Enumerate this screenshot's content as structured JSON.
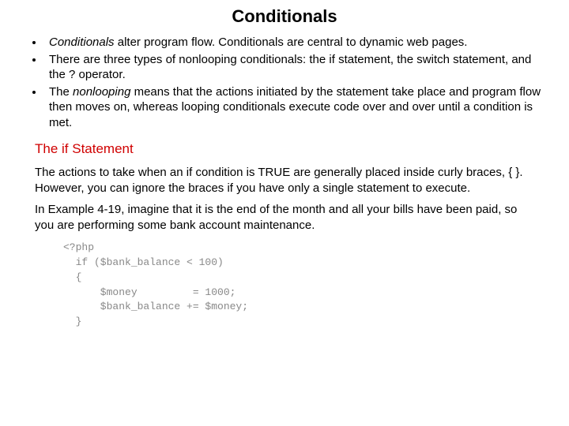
{
  "title": "Conditionals",
  "bullets": {
    "b1_prefix": "Conditionals",
    "b1_rest": " alter program flow. Conditionals are central to dynamic web pages.",
    "b2": "There are three types of nonlooping conditionals: the if statement, the switch statement, and the ? operator.",
    "b3_prefix": "The ",
    "b3_italic": "nonlooping",
    "b3_rest": " means that the actions initiated by the statement take place and program flow then moves on, whereas looping conditionals execute code over and over until a condition is met."
  },
  "subhead": "The if Statement",
  "para1": "The actions to take when an if condition is TRUE are generally placed inside curly braces, { }. However, you can ignore the braces if you have only a single statement to execute.",
  "para2": "In Example 4-19, imagine that it is the end of the month and all your bills have been paid, so you are performing some bank account maintenance.",
  "code": "<?php\n  if ($bank_balance < 100)\n  {\n      $money         = 1000;\n      $bank_balance += $money;\n  }"
}
